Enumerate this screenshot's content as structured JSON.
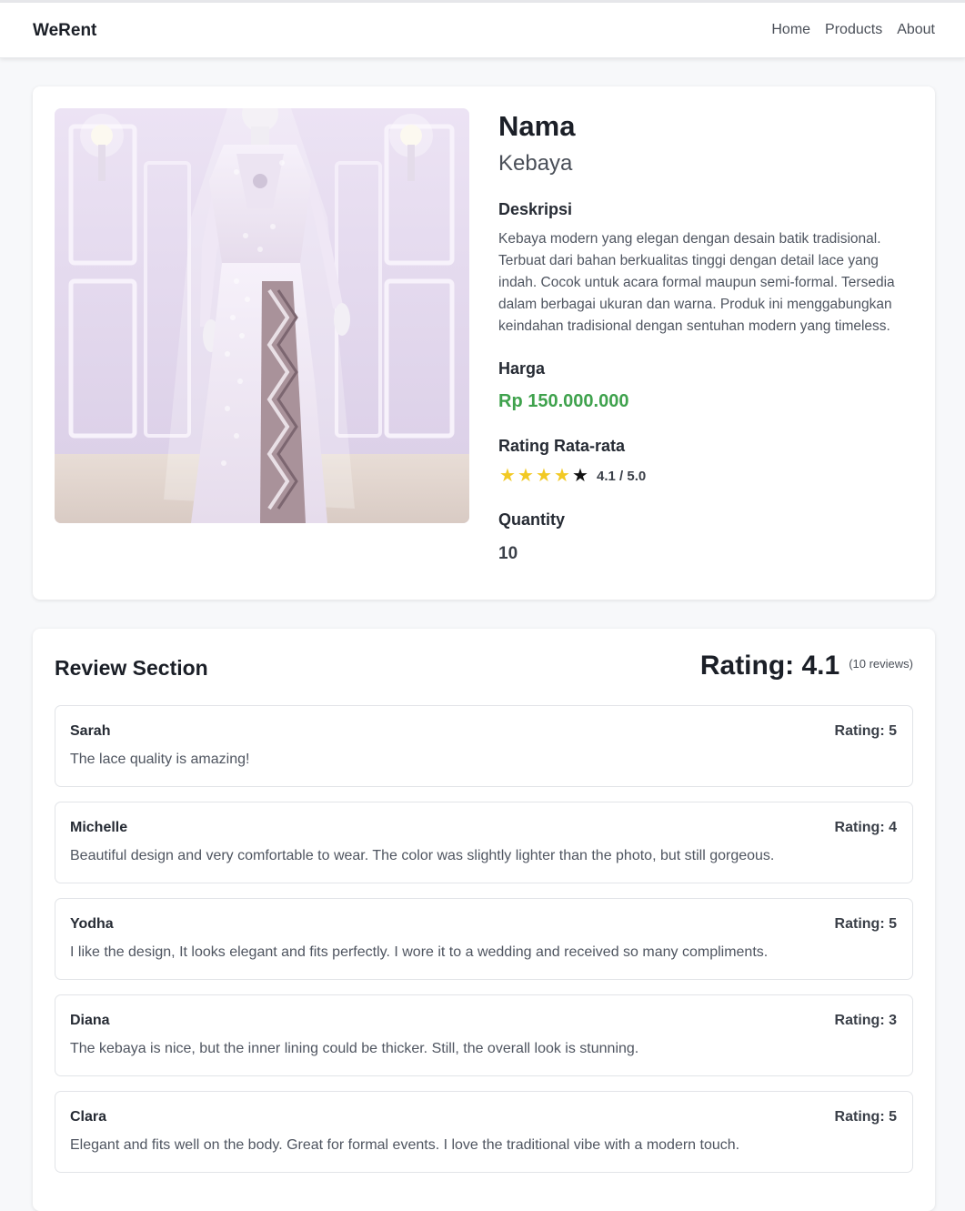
{
  "navbar": {
    "brand": "WeRent",
    "links": [
      "Home",
      "Products",
      "About"
    ]
  },
  "product": {
    "name_heading": "Nama",
    "name": "Kebaya",
    "description_label": "Deskripsi",
    "description": "Kebaya modern yang elegan dengan desain batik tradisional. Terbuat dari bahan berkualitas tinggi dengan detail lace yang indah. Cocok untuk acara formal maupun semi-formal. Tersedia dalam berbagai ukuran dan warna. Produk ini menggabungkan keindahan tradisional dengan sentuhan modern yang timeless.",
    "price_label": "Harga",
    "price": "Rp 150.000.000",
    "rating_label": "Rating Rata-rata",
    "rating_text": "4.1 / 5.0",
    "stars_filled": 4,
    "stars_total": 5,
    "quantity_label": "Quantity",
    "quantity": "10"
  },
  "reviews": {
    "title": "Review Section",
    "summary_rating": "Rating: 4.1",
    "summary_count": "(10 reviews)",
    "items": [
      {
        "user": "Sarah",
        "rating": "Rating: 5",
        "comment": "The lace quality is amazing!"
      },
      {
        "user": "Michelle",
        "rating": "Rating: 4",
        "comment": "Beautiful design and very comfortable to wear. The color was slightly lighter than the photo, but still gorgeous."
      },
      {
        "user": "Yodha",
        "rating": "Rating: 5",
        "comment": "I like the design, It looks elegant and fits perfectly. I wore it to a wedding and received so many compliments."
      },
      {
        "user": "Diana",
        "rating": "Rating: 3",
        "comment": "The kebaya is nice, but the inner lining could be thicker. Still, the overall look is stunning."
      },
      {
        "user": "Clara",
        "rating": "Rating: 5",
        "comment": "Elegant and fits well on the body. Great for formal events. I love the traditional vibe with a modern touch."
      }
    ]
  },
  "colors": {
    "price": "#3fa24d",
    "star_filled": "#f2c924",
    "star_empty": "#121212"
  }
}
